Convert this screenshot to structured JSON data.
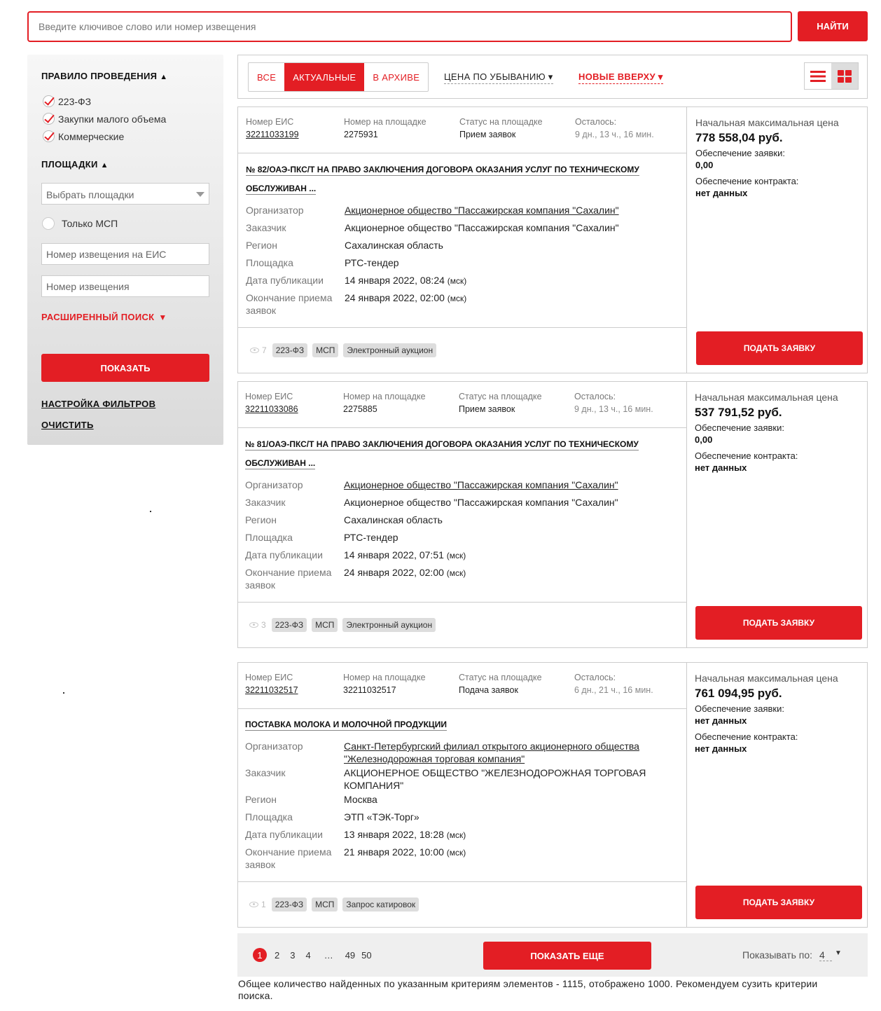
{
  "search": {
    "placeholder": "Введите ключивое слово или номер извещения",
    "button_label": "НАЙТИ"
  },
  "sidebar": {
    "rules_title": "ПРАВИЛО ПРОВЕДЕНИЯ",
    "rules_items": [
      "223-ФЗ",
      "Закупки малого объема",
      "Коммерческие"
    ],
    "platforms_title": "ПЛОЩАДКИ",
    "platforms_select": "Выбрать площадки",
    "only_msp": "Только МСП",
    "eis_number_placeholder": "Номер извещения на ЕИС",
    "notice_number_placeholder": "Номер извещения",
    "advanced_search": "РАСШИРЕННЫЙ ПОИСК",
    "show_button": "ПОКАЗАТЬ",
    "filter_settings": "НАСТРОЙКА ФИЛЬТРОВ",
    "clear": "ОЧИСТИТЬ"
  },
  "toolbar": {
    "tabs": [
      "ВСЕ",
      "АКТУАЛЬНЫЕ",
      "В АРХИВЕ"
    ],
    "active_tab": "АКТУАЛЬНЫЕ",
    "sort_price": "ЦЕНА ПО УБЫВАНИЮ ▾",
    "sort_date": "НОВЫЕ ВВЕРХУ ▾",
    "view_mode": "grid"
  },
  "labels": {
    "eis_number": "Номер ЕИС",
    "platform_number": "Номер на площадке",
    "platform_status": "Статус на площадке",
    "remaining": "Осталось:",
    "organizer": "Организатор",
    "customer": "Заказчик",
    "region": "Регион",
    "platform": "Площадка",
    "publish_date": "Дата публикации",
    "deadline": "Окончание приема заявок",
    "max_price": "Начальная максимальная цена",
    "bid_security": "Обеспечение заявки:",
    "contract_security": "Обеспечение контракта:",
    "apply": "ПОДАТЬ ЗАЯВКУ",
    "msk": "(мск)"
  },
  "cards": [
    {
      "eis_number": "32211033199",
      "platform_number": "2275931",
      "status": "Прием заявок",
      "remaining": "9 дн., 13 ч., 16 мин.",
      "title_line1": "№ 82/ОАЭ-ПКС/Т НА ПРАВО ЗАКЛЮЧЕНИЯ ДОГОВОРА ОКАЗАНИЯ УСЛУГ ПО ТЕХНИЧЕСКОМУ",
      "title_line2": "ОБСЛУЖИВАН ...",
      "organizer": "Акционерное общество \"Пассажирская компания \"Сахалин\"",
      "customer": "Акционерное общество \"Пассажирская компания \"Сахалин\"",
      "region": "Сахалинская область",
      "platform": "РТС-тендер",
      "publish_date": "14 января 2022, 08:24",
      "deadline": "24 января 2022, 02:00",
      "views": "7",
      "tags": [
        "223-ФЗ",
        "МСП",
        "Электронный аукцион"
      ],
      "price": "778 558,04 руб.",
      "bid_security": "0,00",
      "contract_security": "нет данных"
    },
    {
      "eis_number": "32211033086",
      "platform_number": "2275885",
      "status": "Прием заявок",
      "remaining": "9 дн., 13 ч., 16 мин.",
      "title_line1": "№ 81/ОАЭ-ПКС/Т НА ПРАВО ЗАКЛЮЧЕНИЯ ДОГОВОРА ОКАЗАНИЯ УСЛУГ ПО ТЕХНИЧЕСКОМУ",
      "title_line2": "ОБСЛУЖИВАН ...",
      "organizer": "Акционерное общество \"Пассажирская компания \"Сахалин\"",
      "customer": "Акционерное общество \"Пассажирская компания \"Сахалин\"",
      "region": "Сахалинская область",
      "platform": "РТС-тендер",
      "publish_date": "14 января 2022, 07:51",
      "deadline": "24 января 2022, 02:00",
      "views": "3",
      "tags": [
        "223-ФЗ",
        "МСП",
        "Электронный аукцион"
      ],
      "price": "537 791,52 руб.",
      "bid_security": "0,00",
      "contract_security": "нет данных"
    },
    {
      "eis_number": "32211032517",
      "platform_number": "32211032517",
      "status": "Подача заявок",
      "remaining": "6 дн., 21 ч., 16 мин.",
      "title_line1": "ПОСТАВКА МОЛОКА И МОЛОЧНОЙ ПРОДУКЦИИ",
      "organizer": "Санкт-Петербургский филиал открытого акционерного общества \"Железнодорожная торговая компания\"",
      "customer": "АКЦИОНЕРНОЕ ОБЩЕСТВО \"ЖЕЛЕЗНОДОРОЖНАЯ ТОРГОВАЯ КОМПАНИЯ\"",
      "region": "Москва",
      "platform": "ЭТП «ТЭК-Торг»",
      "publish_date": "13 января 2022, 18:28",
      "deadline": "21 января 2022, 10:00",
      "views": "1",
      "tags": [
        "223-ФЗ",
        "МСП",
        "Запрос катировок"
      ],
      "price": "761 094,95 руб.",
      "bid_security": "нет данных",
      "contract_security": "нет данных"
    }
  ],
  "pagination": {
    "pages": [
      "1",
      "2",
      "3",
      "4",
      "…",
      "49",
      "50"
    ],
    "current": "1",
    "show_more": "ПОКАЗАТЬ ЕЩЕ",
    "per_page_label": "Показывать по:",
    "per_page_value": "4"
  },
  "total_note": "Общее количество найденных по указанным критериям элементов - 1115, отображено 1000. Рекомендуем сузить критерии поиска.",
  "colors": {
    "accent": "#e31e24"
  }
}
